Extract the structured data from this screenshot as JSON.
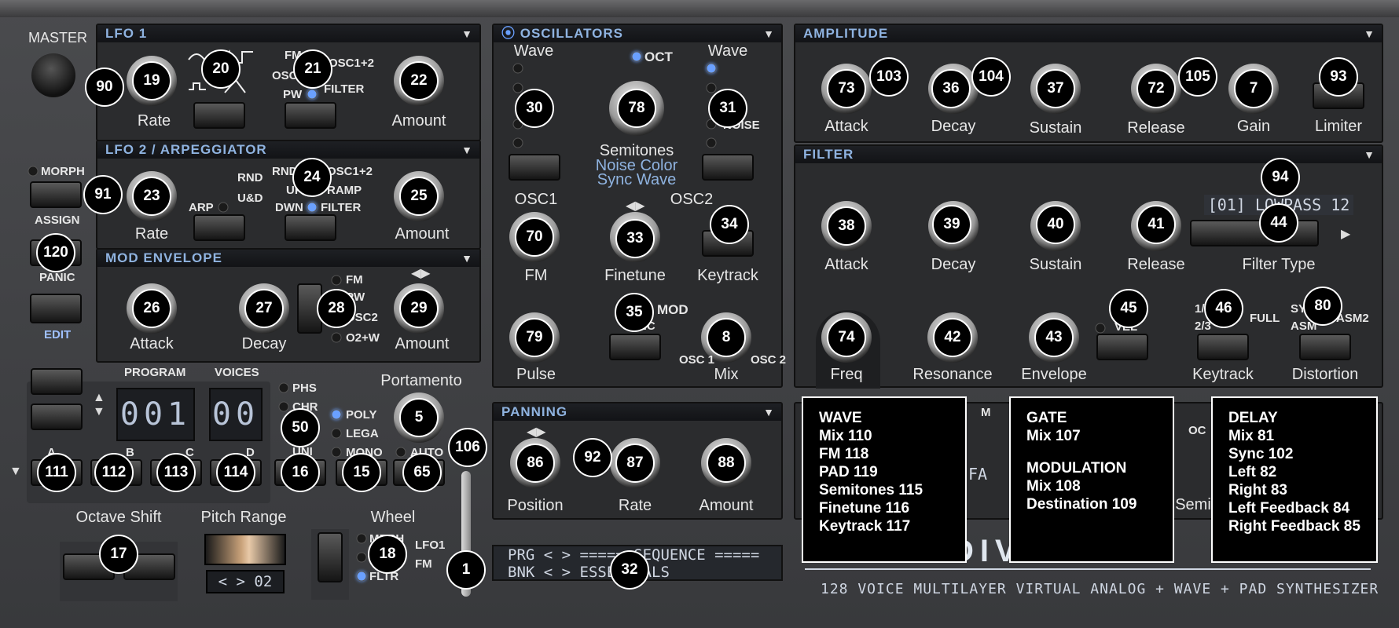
{
  "master": {
    "label": "MASTER"
  },
  "lfo1": {
    "title": "LFO 1",
    "rate": "Rate",
    "amount": "Amount",
    "fm": "FM",
    "osc": "OSC",
    "osc12": "OSC1+2",
    "pw": "PW",
    "filter": "FILTER"
  },
  "lfo2": {
    "title": "LFO 2 / ARPEGGIATOR",
    "rate": "Rate",
    "amount": "Amount",
    "arp": "ARP",
    "rnd": "RND",
    "ud": "U&D",
    "dwn": "DWN",
    "up": "UP",
    "ramp": "RAMP",
    "osc12": "OSC1+2",
    "filter": "FILTER"
  },
  "modenv": {
    "title": "MOD ENVELOPE",
    "attack": "Attack",
    "decay": "Decay",
    "amount": "Amount",
    "fm": "FM",
    "pw": "PW",
    "osc2": "OSC2",
    "o2w": "O2+W"
  },
  "left": {
    "morph": "MORPH",
    "assign": "ASSIGN",
    "panic": "PANIC",
    "edit": "EDIT"
  },
  "osc": {
    "title": "OSCILLATORS",
    "wave1": "Wave",
    "wave2": "Wave",
    "oct": "OCT",
    "semitones": "Semitones",
    "noise_color": "Noise Color",
    "sync_wave": "Sync Wave",
    "noise": "NOISE",
    "osc1": "OSC1",
    "osc2": "OSC2",
    "fm": "FM",
    "finetune": "Finetune",
    "keytrack": "Keytrack",
    "mod": "MOD",
    "sync": "SYNC",
    "pulse": "Pulse",
    "mix": "Mix",
    "osc1_short": "OSC 1",
    "osc2_short": "OSC 2"
  },
  "amp": {
    "title": "AMPLITUDE",
    "attack": "Attack",
    "decay": "Decay",
    "sustain": "Sustain",
    "release": "Release",
    "gain": "Gain",
    "limiter": "Limiter"
  },
  "filter": {
    "title": "FILTER",
    "attack": "Attack",
    "decay": "Decay",
    "sustain": "Sustain",
    "release": "Release",
    "type_display": "[01] LOWPASS 12",
    "filter_type": "Filter Type",
    "freq": "Freq",
    "resonance": "Resonance",
    "envelope": "Envelope",
    "keytrack": "Keytrack",
    "distortion": "Distortion",
    "vel": "VEL",
    "k1": "1/",
    "k23": "2/3",
    "full": "FULL",
    "sy": "SY",
    "asm": "ASM",
    "asm2": "ASM2"
  },
  "prog": {
    "program": "PROGRAM",
    "voices": "VOICES",
    "program_val": "001",
    "voices_val": "00",
    "phs": "PHS",
    "chr": "CHR",
    "uni": "UNI",
    "poly": "POLY",
    "lega": "LEGA",
    "mono": "MONO",
    "portamento": "Portamento",
    "auto": "AUTO",
    "a": "A",
    "b": "B",
    "c": "C",
    "d": "D"
  },
  "bottom": {
    "octave_shift": "Octave Shift",
    "pitch_range": "Pitch Range",
    "pitch_val": "< > 02",
    "wheel": "Wheel",
    "morph": "MRPH",
    "lfo1": "LFO1",
    "fm": "FM",
    "fltr": "FLTR"
  },
  "panning": {
    "title": "PANNING",
    "position": "Position",
    "rate": "Rate",
    "amount": "Amount"
  },
  "seq": {
    "line1": "PRG < > ===== SEQUENCE =====",
    "line2": "BNK < > ESSENTIALS"
  },
  "brand": {
    "subtitle": "128 VOICE MULTILAYER VIRTUAL ANALOG + WAVE + PAD SYNTHESIZER",
    "logo": "DIVERSE"
  },
  "fx": {
    "m": "M",
    "oc": "OC",
    "fa": "FA",
    "semi": "Semi"
  },
  "popups": [
    {
      "lines": [
        "WAVE",
        "Mix 110",
        "FM 118",
        "PAD 119",
        "Semitones 115",
        "Finetune 116",
        "Keytrack 117"
      ]
    },
    {
      "lines": [
        "GATE",
        "Mix 107",
        "",
        "MODULATION",
        "Mix 108",
        "Destination 109"
      ]
    },
    {
      "lines": [
        "DELAY",
        "Mix 81",
        "Sync 102",
        "Left 82",
        "Right 83",
        "Left Feedback 84",
        "Right Feedback 85"
      ]
    }
  ],
  "badges": [
    "90",
    "19",
    "20",
    "21",
    "22",
    "91",
    "23",
    "24",
    "25",
    "120",
    "26",
    "27",
    "28",
    "29",
    "30",
    "78",
    "31",
    "70",
    "33",
    "34",
    "35",
    "79",
    "8",
    "73",
    "103",
    "36",
    "104",
    "37",
    "72",
    "105",
    "7",
    "93",
    "94",
    "44",
    "38",
    "39",
    "40",
    "41",
    "74",
    "42",
    "43",
    "45",
    "46",
    "80",
    "111",
    "112",
    "113",
    "114",
    "16",
    "15",
    "65",
    "50",
    "5",
    "106",
    "17",
    "18",
    "1",
    "86",
    "92",
    "87",
    "88",
    "32"
  ]
}
